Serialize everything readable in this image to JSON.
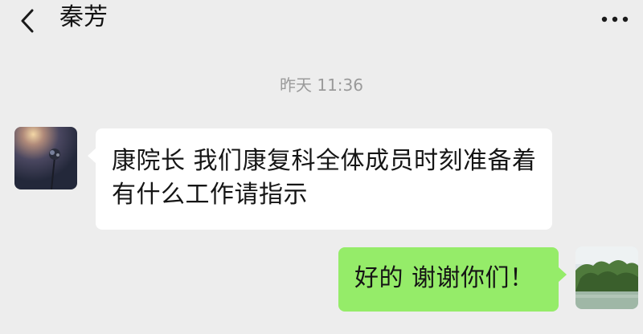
{
  "header": {
    "back_icon": "chevron-left-icon",
    "title": "秦芳",
    "more_icon": "more-dots-icon"
  },
  "chat": {
    "timestamp": "昨天 11:36",
    "messages": [
      {
        "side": "left",
        "text": "康院长  我们康复科全体成员时刻准备着  有什么工作请指示",
        "bubble_color": "#ffffff"
      },
      {
        "side": "right",
        "text": "好的 谢谢你们！",
        "bubble_color": "#95ec69"
      }
    ]
  },
  "colors": {
    "background": "#ededed",
    "timestamp_text": "#9a9a9a",
    "sent_bubble": "#95ec69",
    "received_bubble": "#ffffff"
  }
}
